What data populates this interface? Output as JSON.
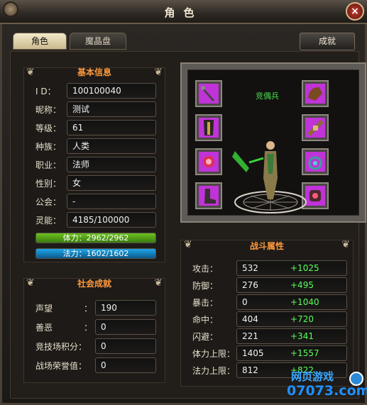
{
  "window": {
    "title": "角色",
    "close": "×"
  },
  "tabs": [
    {
      "label": "角色"
    },
    {
      "label": "魔晶盘"
    }
  ],
  "achievement_button": "成就",
  "basic_info": {
    "title": "基本信息",
    "rows": [
      {
        "label": "I D：",
        "value": "100100040"
      },
      {
        "label": "昵称：",
        "value": "测试"
      },
      {
        "label": "等级：",
        "value": "61"
      },
      {
        "label": "种族：",
        "value": "人类"
      },
      {
        "label": "职业：",
        "value": "法师"
      },
      {
        "label": "性别：",
        "value": "女"
      },
      {
        "label": "公会：",
        "value": "-"
      },
      {
        "label": "灵能：",
        "value": "4185/100000"
      }
    ],
    "hp": {
      "text": "体力：2962/2962",
      "fraction": 1.0,
      "color": "#6cc21f"
    },
    "mp": {
      "text": "法力：1602/1602",
      "fraction": 1.0,
      "color": "#1fa6e8"
    }
  },
  "social": {
    "title": "社会成就",
    "rows": [
      {
        "label": "声望",
        "colon": "：",
        "value": "190"
      },
      {
        "label": "善恶",
        "colon": "：",
        "value": "0"
      },
      {
        "label": "竞技场积分：",
        "colon": "",
        "value": "0"
      },
      {
        "label": "战场荣誉值：",
        "colon": "",
        "value": "0"
      }
    ]
  },
  "equipment": {
    "character_name": "竞偶兵"
  },
  "combat": {
    "title": "战斗属性",
    "rows": [
      {
        "label": "攻击：",
        "value": "532",
        "bonus": "+1025"
      },
      {
        "label": "防御：",
        "value": "276",
        "bonus": "+495"
      },
      {
        "label": "暴击：",
        "value": "0",
        "bonus": "+1040"
      },
      {
        "label": "命中：",
        "value": "404",
        "bonus": "+720"
      },
      {
        "label": "闪避：",
        "value": "221",
        "bonus": "+341"
      },
      {
        "label": "体力上限：",
        "value": "1405",
        "bonus": "+1557"
      },
      {
        "label": "法力上限：",
        "value": "812",
        "bonus": "+822"
      }
    ]
  },
  "watermark": {
    "line1": "网页游戏",
    "line2": "07073.com"
  }
}
